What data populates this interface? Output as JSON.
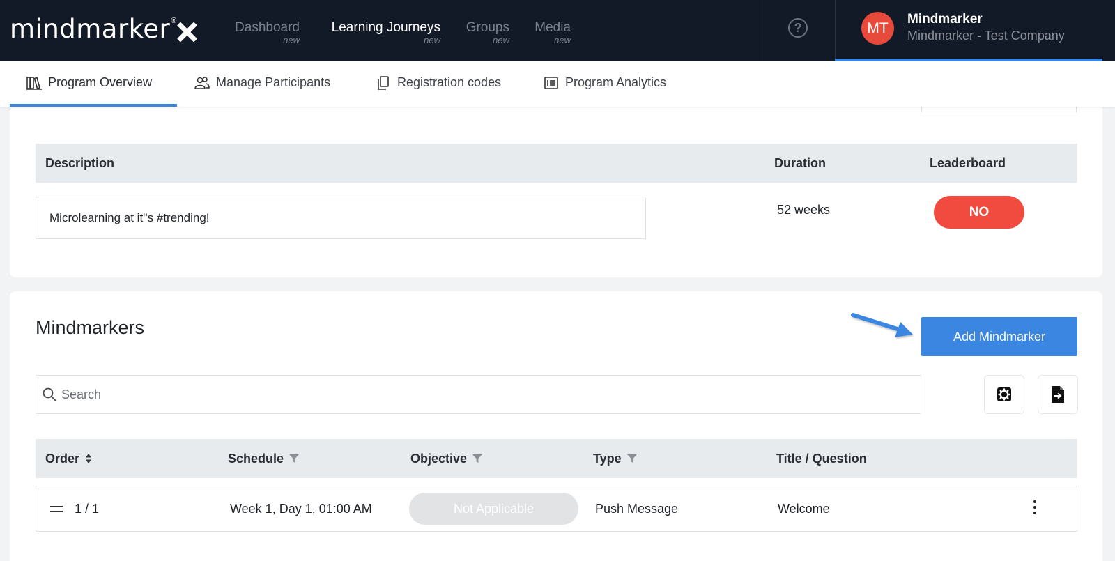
{
  "app": {
    "logo_text": "mindmarker",
    "logo_reg": "®"
  },
  "top_nav": [
    {
      "label": "Dashboard",
      "sub": "new",
      "active": false
    },
    {
      "label": "Learning Journeys",
      "sub": "new",
      "active": true
    },
    {
      "label": "Groups",
      "sub": "new",
      "active": false
    },
    {
      "label": "Media",
      "sub": "new",
      "active": false
    }
  ],
  "help_label": "?",
  "account": {
    "initials": "MT",
    "name": "Mindmarker",
    "company": "Mindmarker - Test Company",
    "avatar_color": "#e74a3b"
  },
  "sub_nav": [
    {
      "label": "Program Overview",
      "icon": "books-icon",
      "active": true
    },
    {
      "label": "Manage Participants",
      "icon": "users-icon",
      "active": false
    },
    {
      "label": "Registration codes",
      "icon": "copy-icon",
      "active": false
    },
    {
      "label": "Program Analytics",
      "icon": "list-icon",
      "active": false
    }
  ],
  "program": {
    "headers": {
      "description": "Description",
      "duration": "Duration",
      "leaderboard": "Leaderboard"
    },
    "description": "Microlearning at it''s #trending!",
    "duration": "52 weeks",
    "leaderboard": "NO"
  },
  "mindmarkers": {
    "title": "Mindmarkers",
    "add_label": "Add Mindmarker",
    "search_placeholder": "Search",
    "columns": [
      "Order",
      "Schedule",
      "Objective",
      "Type",
      "Title / Question"
    ],
    "rows": [
      {
        "order": "1 / 1",
        "schedule": "Week 1, Day 1, 01:00 AM",
        "objective": "Not Applicable",
        "type": "Push Message",
        "title": "Welcome"
      }
    ]
  },
  "colors": {
    "nav_bg": "#131a27",
    "accent": "#3a86e0",
    "danger": "#f04b3e",
    "header_bg": "#e8ebee"
  }
}
